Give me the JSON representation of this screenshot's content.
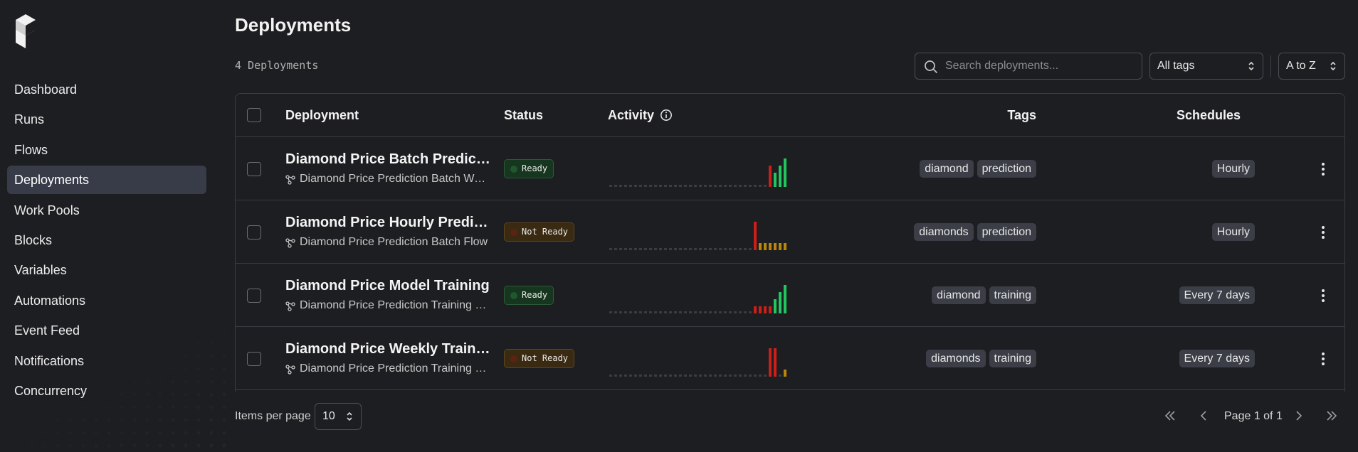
{
  "sidebar": {
    "logo_icon": "prefect-logo-icon",
    "items": [
      {
        "label": "Dashboard",
        "active": false
      },
      {
        "label": "Runs",
        "active": false
      },
      {
        "label": "Flows",
        "active": false
      },
      {
        "label": "Deployments",
        "active": true
      },
      {
        "label": "Work Pools",
        "active": false
      },
      {
        "label": "Blocks",
        "active": false
      },
      {
        "label": "Variables",
        "active": false
      },
      {
        "label": "Automations",
        "active": false
      },
      {
        "label": "Event Feed",
        "active": false
      },
      {
        "label": "Notifications",
        "active": false
      },
      {
        "label": "Concurrency",
        "active": false
      }
    ]
  },
  "header": {
    "title": "Deployments",
    "count_label": "4 Deployments"
  },
  "filters": {
    "search_placeholder": "Search deployments...",
    "search_value": "",
    "tags_select": "All tags",
    "sort_select": "A to Z"
  },
  "table": {
    "columns": {
      "deployment": "Deployment",
      "status": "Status",
      "activity": "Activity",
      "tags": "Tags",
      "schedules": "Schedules"
    },
    "rows": [
      {
        "name": "Diamond Price Batch Prediction",
        "flow": "Diamond Price Prediction Batch Workflow",
        "status": "Ready",
        "status_kind": "ready",
        "tags": [
          "diamond",
          "prediction"
        ],
        "schedule": "Hourly",
        "activity": [
          "0",
          "0",
          "0",
          "0",
          "0",
          "0",
          "0",
          "0",
          "0",
          "0",
          "0",
          "0",
          "0",
          "0",
          "0",
          "0",
          "0",
          "0",
          "0",
          "0",
          "0",
          "0",
          "0",
          "0",
          "0",
          "0",
          "0",
          "0",
          "0",
          "0",
          "0",
          "0",
          "r3",
          "g2",
          "g3",
          "g4"
        ]
      },
      {
        "name": "Diamond Price Hourly Prediction",
        "flow": "Diamond Price Prediction Batch Flow",
        "status": "Not Ready",
        "status_kind": "notready",
        "tags": [
          "diamonds",
          "prediction"
        ],
        "schedule": "Hourly",
        "activity": [
          "0",
          "0",
          "0",
          "0",
          "0",
          "0",
          "0",
          "0",
          "0",
          "0",
          "0",
          "0",
          "0",
          "0",
          "0",
          "0",
          "0",
          "0",
          "0",
          "0",
          "0",
          "0",
          "0",
          "0",
          "0",
          "0",
          "0",
          "0",
          "0",
          "r4",
          "y1",
          "y1",
          "y1",
          "y1",
          "y1",
          "y1"
        ]
      },
      {
        "name": "Diamond Price Model Training",
        "flow": "Diamond Price Prediction Training Flow",
        "status": "Ready",
        "status_kind": "ready",
        "tags": [
          "diamond",
          "training"
        ],
        "schedule": "Every 7 days",
        "activity": [
          "0",
          "0",
          "0",
          "0",
          "0",
          "0",
          "0",
          "0",
          "0",
          "0",
          "0",
          "0",
          "0",
          "0",
          "0",
          "0",
          "0",
          "0",
          "0",
          "0",
          "0",
          "0",
          "0",
          "0",
          "0",
          "0",
          "0",
          "0",
          "0",
          "r1",
          "r1",
          "r1",
          "r1",
          "g2",
          "g3",
          "g4"
        ]
      },
      {
        "name": "Diamond Price Weekly Training",
        "flow": "Diamond Price Prediction Training Flow",
        "status": "Not Ready",
        "status_kind": "notready",
        "tags": [
          "diamonds",
          "training"
        ],
        "schedule": "Every 7 days",
        "activity": [
          "0",
          "0",
          "0",
          "0",
          "0",
          "0",
          "0",
          "0",
          "0",
          "0",
          "0",
          "0",
          "0",
          "0",
          "0",
          "0",
          "0",
          "0",
          "0",
          "0",
          "0",
          "0",
          "0",
          "0",
          "0",
          "0",
          "0",
          "0",
          "0",
          "0",
          "0",
          "0",
          "r4",
          "r4",
          "0",
          "y1"
        ]
      }
    ]
  },
  "footer": {
    "items_per_page_label": "Items per page",
    "items_per_page_value": "10",
    "page_label": "Page 1 of 1"
  },
  "colors": {
    "ready": "#22c55e",
    "failed": "#cc1f1a",
    "late": "#b8860b",
    "empty": "#3a3c42",
    "active_nav": "#383c48"
  }
}
